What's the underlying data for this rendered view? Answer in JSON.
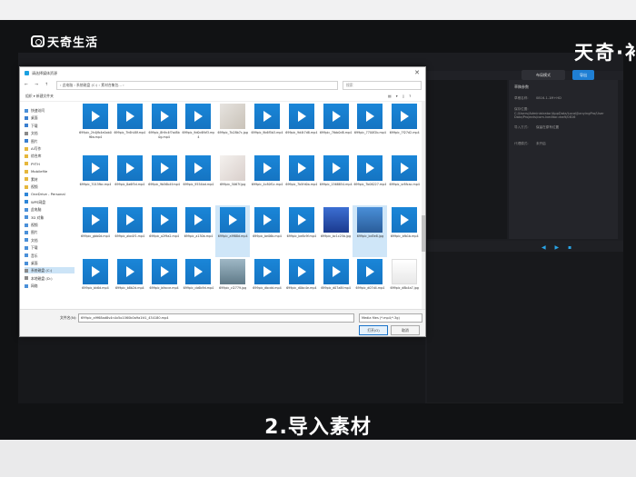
{
  "watermark": {
    "left": "天奇生活",
    "right": "天奇·补"
  },
  "caption": "2.导入素材",
  "app": {
    "buttons": {
      "layout": "布局模式",
      "export": "导出"
    },
    "properties": {
      "title": "草稿参数",
      "rows": [
        {
          "label": "草稿名称:",
          "value": "0816-1-1M+HD"
        },
        {
          "label": "保存位置:",
          "value": "C:/Users/Administrator/AppData/Local/JianyingPro/User Data/Projects/com.lveditor.draft/0816"
        },
        {
          "label": "导入方式:",
          "value": "保留在原有位置"
        },
        {
          "label": "代理模式:",
          "value": "未开启"
        }
      ]
    },
    "timeline_icons": "◀ ▶ ▪"
  },
  "dialog": {
    "title": "请选择媒体资源",
    "address": {
      "nav": "← → ↑",
      "path": "› 此电脑 › 系统磁盘 (C:) › 素材合集包... ›",
      "search": "搜索"
    },
    "commands": {
      "organize": "组织 ▾    新建文件夹",
      "view": "▤ ▾ ▯ ?"
    },
    "sidebar": [
      {
        "label": "快速访问",
        "color": "#4a90d9"
      },
      {
        "label": "桌面",
        "color": "#3a7fd0"
      },
      {
        "label": "下载",
        "color": "#3a7fd0"
      },
      {
        "label": "文档",
        "color": "#8a8a8a"
      },
      {
        "label": "图片",
        "color": "#3a7fd0"
      },
      {
        "label": "AI写作",
        "color": "#e6b73c"
      },
      {
        "label": "综合库",
        "color": "#e6b73c"
      },
      {
        "label": "PYTH",
        "color": "#e6b73c"
      },
      {
        "label": "Mobilefile",
        "color": "#e6b73c"
      },
      {
        "label": "素材",
        "color": "#e6b73c"
      },
      {
        "label": "视频",
        "color": "#e6b73c"
      },
      {
        "label": "OneDrive - Personal",
        "color": "#2e86d8"
      },
      {
        "label": "WPS网盘",
        "color": "#2e86d8"
      },
      {
        "label": "此电脑",
        "color": "#4a90d9"
      },
      {
        "label": "3D 对象",
        "color": "#4a90d9"
      },
      {
        "label": "视频",
        "color": "#4a90d9"
      },
      {
        "label": "图片",
        "color": "#4a90d9"
      },
      {
        "label": "文档",
        "color": "#4a90d9"
      },
      {
        "label": "下载",
        "color": "#4a90d9"
      },
      {
        "label": "音乐",
        "color": "#4a90d9"
      },
      {
        "label": "桌面",
        "color": "#4a90d9"
      },
      {
        "label": "系统磁盘 (C:)",
        "color": "#8a8a8a"
      },
      {
        "label": "本地磁盘 (D:)",
        "color": "#8a8a8a"
      },
      {
        "label": "网络",
        "color": "#4a90d9"
      }
    ],
    "files": [
      {
        "name": "699pic_2h4jfb4e0ob0f6w.mp4",
        "kind": "vid"
      },
      {
        "name": "699pic_7h6h48f.mp4",
        "kind": "vid"
      },
      {
        "name": "699pic_8h9c4f7sd8b0g.mp4",
        "kind": "vid"
      },
      {
        "name": "699pic_9d0c6fbf3.mp4",
        "kind": "vid"
      },
      {
        "name": "699pic_7b28b7c.jpg",
        "kind": "img1"
      },
      {
        "name": "699pic_9b6f5b3.mp4",
        "kind": "vid"
      },
      {
        "name": "699pic_9d4t7d8.mp4",
        "kind": "vid"
      },
      {
        "name": "699pic_7tbb0d8.mp4",
        "kind": "vid"
      },
      {
        "name": "699pic_7700f2b.mp4",
        "kind": "vid"
      },
      {
        "name": "699pic_7f27d2.mp4",
        "kind": "vid"
      },
      {
        "name": "699pic_7015fbc.mp4",
        "kind": "vid"
      },
      {
        "name": "699pic_8a6f5d.mp4",
        "kind": "vid"
      },
      {
        "name": "699pic_9b56b4f.mp4",
        "kind": "vid"
      },
      {
        "name": "699pic_9554bd.mp4",
        "kind": "vid"
      },
      {
        "name": "699pic_5067f.jpg",
        "kind": "img2"
      },
      {
        "name": "699pic_4c80f1c.mp4",
        "kind": "vid"
      },
      {
        "name": "699pic_7b5fd0a.mp4",
        "kind": "vid"
      },
      {
        "name": "699pic_1568854.mp4",
        "kind": "vid"
      },
      {
        "name": "699pic_7b06227.mp4",
        "kind": "vid"
      },
      {
        "name": "699pic_vr8fcac.mp4",
        "kind": "vid"
      },
      {
        "name": "699pic_gbb0d.mp4",
        "kind": "vid"
      },
      {
        "name": "699pic_abc0f1.mp4",
        "kind": "vid"
      },
      {
        "name": "699pic_a2f9a2.mp4",
        "kind": "vid"
      },
      {
        "name": "699pic_a130b.mp4",
        "kind": "vid"
      },
      {
        "name": "699pic_a9f68d.mp4",
        "kind": "vid"
      },
      {
        "name": "699pic_be06b.mp4",
        "kind": "vid"
      },
      {
        "name": "699pic_be8c9f.mp4",
        "kind": "vid"
      },
      {
        "name": "699pic_bc1c25b.jpg",
        "kind": "img3"
      },
      {
        "name": "699pic_bd5e8.jpg",
        "kind": "img4"
      },
      {
        "name": "699pic_bfb1b.mp4",
        "kind": "vid"
      },
      {
        "name": "699pic_bk6d.mp4",
        "kind": "vid"
      },
      {
        "name": "699pic_b8b2d.mp4",
        "kind": "vid"
      },
      {
        "name": "699pic_bfacce.mp4",
        "kind": "vid"
      },
      {
        "name": "699pic_cb6b9d.mp4",
        "kind": "vid"
      },
      {
        "name": "699pic_cl2779.jpg",
        "kind": "img5"
      },
      {
        "name": "699pic_dbcdd.mp4",
        "kind": "vid"
      },
      {
        "name": "699pic_d0bc4e.mp4",
        "kind": "vid"
      },
      {
        "name": "699pic_d07a8f.mp4",
        "kind": "vid"
      },
      {
        "name": "699pic_d07d4.mp4",
        "kind": "vid"
      },
      {
        "name": "699pic_d8b4a7.jpg",
        "kind": "img6"
      },
      {
        "name": "699pic_d80ad0.mp4",
        "kind": "vid"
      },
      {
        "name": "699pic_dk0bd2.mp4",
        "kind": "vid"
      }
    ],
    "footer": {
      "label": "文件名(N):",
      "filename": "699pic_a9f68ad8v4n4x5o1060b0a9a1tt1_434180.mp4",
      "filetype": "Media files (*.mp4;*.3g)",
      "open": "打开(O)",
      "cancel": "取消"
    }
  }
}
